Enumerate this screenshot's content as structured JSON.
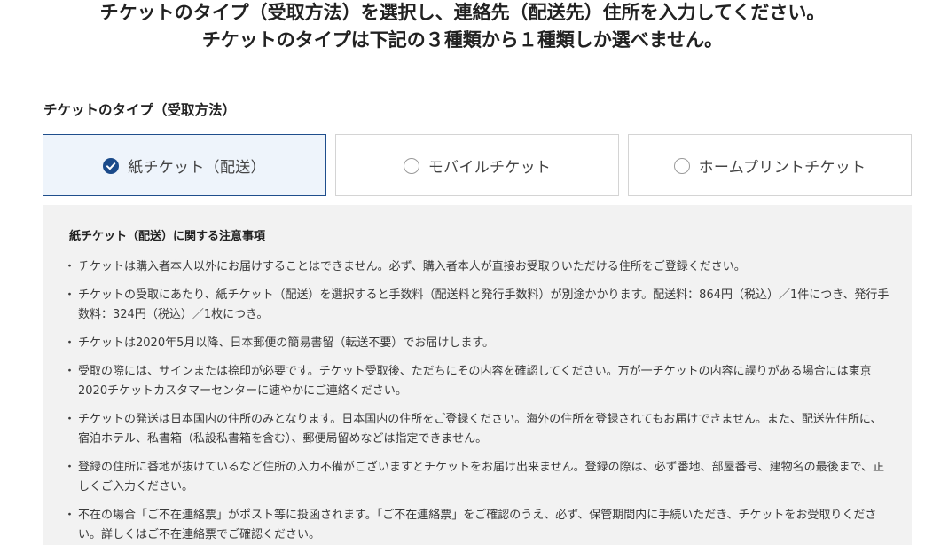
{
  "header": {
    "line1": "チケットのタイプ（受取方法）を選択し、連絡先（配送先）住所を入力してください。",
    "line2": "チケットのタイプは下記の３種類から１種類しか選べません。"
  },
  "ticket_type": {
    "title": "チケットのタイプ（受取方法）",
    "options": [
      {
        "label": "紙チケット（配送）",
        "selected": true
      },
      {
        "label": "モバイルチケット",
        "selected": false
      },
      {
        "label": "ホームプリントチケット",
        "selected": false
      }
    ]
  },
  "notes": {
    "title": "紙チケット（配送）に関する注意事項",
    "items": [
      "チケットは購入者本人以外にお届けすることはできません。必ず、購入者本人が直接お受取りいただける住所をご登録ください。",
      "チケットの受取にあたり、紙チケット（配送）を選択すると手数料（配送料と発行手数料）が別途かかります。配送料：864円（税込）／1件につき、発行手数料：324円（税込）／1枚につき。",
      "チケットは2020年5月以降、日本郵便の簡易書留（転送不要）でお届けします。",
      "受取の際には、サインまたは捺印が必要です。チケット受取後、ただちにその内容を確認してください。万が一チケットの内容に誤りがある場合には東京2020チケットカスタマーセンターに速やかにご連絡ください。",
      "チケットの発送は日本国内の住所のみとなります。日本国内の住所をご登録ください。海外の住所を登録されてもお届けできません。また、配送先住所に、宿泊ホテル、私書箱（私設私書箱を含む）、郵便局留めなどは指定できません。",
      "登録の住所に番地が抜けているなど住所の入力不備がございますとチケットをお届け出来ません。登録の際は、必ず番地、部屋番号、建物名の最後まで、正しくご入力ください。",
      "不在の場合「ご不在連絡票」がポスト等に投函されます。「ご不在連絡票」をご確認のうえ、必ず、保管期間内に手続いただき、チケットをお受取りください。詳しくはご不在連絡票でご確認ください。"
    ]
  },
  "colors": {
    "selected_border": "#1f4e8c",
    "selected_background": "#eef4fb",
    "check_fill": "#1a4a8a",
    "notes_background": "#f2f2f2"
  },
  "icons": {
    "selected": "check-circle-icon",
    "unselected": "radio-empty-icon"
  }
}
